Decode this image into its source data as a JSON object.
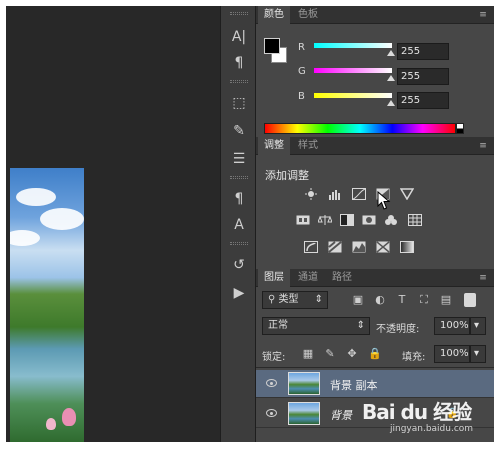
{
  "color_panel": {
    "tabs": [
      {
        "label": "颜色",
        "active": true
      },
      {
        "label": "色板",
        "active": false
      }
    ],
    "foreground": "#000000",
    "background": "#ffffff",
    "channels": [
      {
        "label": "R",
        "value": "255",
        "gradient": "#00ffff"
      },
      {
        "label": "G",
        "value": "255",
        "gradient": "#ff00ff"
      },
      {
        "label": "B",
        "value": "255",
        "gradient": "#ffff00"
      }
    ]
  },
  "adjustments_panel": {
    "tabs": [
      {
        "label": "调整",
        "active": true
      },
      {
        "label": "样式",
        "active": false
      }
    ],
    "title": "添加调整",
    "icons": [
      "brightness-contrast-icon",
      "levels-icon",
      "curves-icon",
      "exposure-icon",
      "vibrance-icon",
      "hue-saturation-icon",
      "color-balance-icon",
      "black-white-icon",
      "photo-filter-icon",
      "channel-mixer-icon",
      "color-lookup-icon",
      "invert-icon",
      "posterize-icon",
      "threshold-icon",
      "selective-color-icon",
      "gradient-map-icon"
    ]
  },
  "layers_panel": {
    "tabs": [
      {
        "label": "图层",
        "active": true
      },
      {
        "label": "通道",
        "active": false
      },
      {
        "label": "路径",
        "active": false
      }
    ],
    "filter_type": "类型",
    "blend_mode": "正常",
    "opacity_label": "不透明度:",
    "opacity": "100%",
    "lock_label": "锁定:",
    "fill_label": "填充:",
    "fill": "100%",
    "layers": [
      {
        "name": "背景 副本",
        "selected": true
      },
      {
        "name": "背景",
        "selected": false,
        "locked": true
      }
    ]
  },
  "watermark": {
    "brand": "Bai du 经验",
    "url": "jingyan.baidu.com"
  }
}
